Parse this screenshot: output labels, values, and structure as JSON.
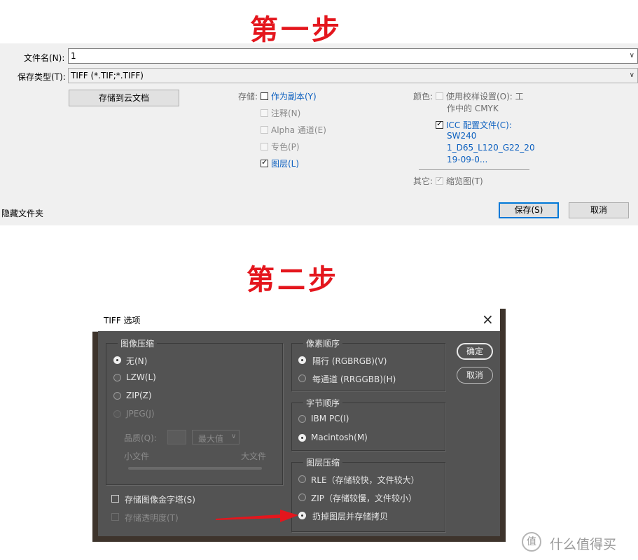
{
  "step1": {
    "title": "第一步"
  },
  "step2": {
    "title": "第二步"
  },
  "save_dialog": {
    "filename_label": "文件名(N):",
    "filename_value": "1",
    "filetype_label": "保存类型(T):",
    "filetype_value": "TIFF (*.TIF;*.TIFF)",
    "cloud_button": "存储到云文档",
    "store_label": "存储:",
    "store_options": [
      {
        "label": "作为副本(Y)",
        "checked": false,
        "disabled": false
      },
      {
        "label": "注释(N)",
        "checked": false,
        "disabled": true
      },
      {
        "label": "Alpha 通道(E)",
        "checked": false,
        "disabled": true
      },
      {
        "label": "专色(P)",
        "checked": false,
        "disabled": true
      },
      {
        "label": "图层(L)",
        "checked": true,
        "disabled": false
      }
    ],
    "color_label": "颜色:",
    "proof_line1": "使用校样设置(O):  工",
    "proof_line2": "作中的 CMYK",
    "icc_line1": "ICC 配置文件(C):",
    "icc_line2": "SW240",
    "icc_line3": "1_D65_L120_G22_20",
    "icc_line4": "19-09-0...",
    "other_label": "其它:",
    "thumbnail_label": "缩览图(T)",
    "hide_folders": "隐藏文件夹",
    "save_button": "保存(S)",
    "cancel_button": "取消"
  },
  "tiff_dialog": {
    "title": "TIFF 选项",
    "close_glyph": "×",
    "image_compression": {
      "title": "图像压缩",
      "options": [
        "无(N)",
        "LZW(L)",
        "ZIP(Z)",
        "JPEG(J)"
      ],
      "quality_label": "品质(Q):",
      "quality_select": "最大值",
      "small_file": "小文件",
      "large_file": "大文件"
    },
    "pixel_order": {
      "title": "像素顺序",
      "options": [
        "隔行 (RGBRGB)(V)",
        "每通道 (RRGGBB)(H)"
      ]
    },
    "byte_order": {
      "title": "字节顺序",
      "options": [
        "IBM PC(I)",
        "Macintosh(M)"
      ]
    },
    "layer_compression": {
      "title": "图层压缩",
      "options": [
        "RLE（存储较快，文件较大）",
        "ZIP（存储较慢，文件较小）",
        "扔掉图层并存储拷贝"
      ]
    },
    "save_pyramid": "存储图像金字塔(S)",
    "save_transparency": "存储透明度(T)",
    "ok_button": "确定",
    "cancel_button": "取消"
  },
  "watermark": {
    "text": "什么值得买",
    "logo_glyph": "值"
  },
  "colors": {
    "annotation_red": "#e4161d",
    "ps_panel": "#535353",
    "win_panel": "#f0f0f0",
    "link_blue": "#0b5fbf"
  }
}
